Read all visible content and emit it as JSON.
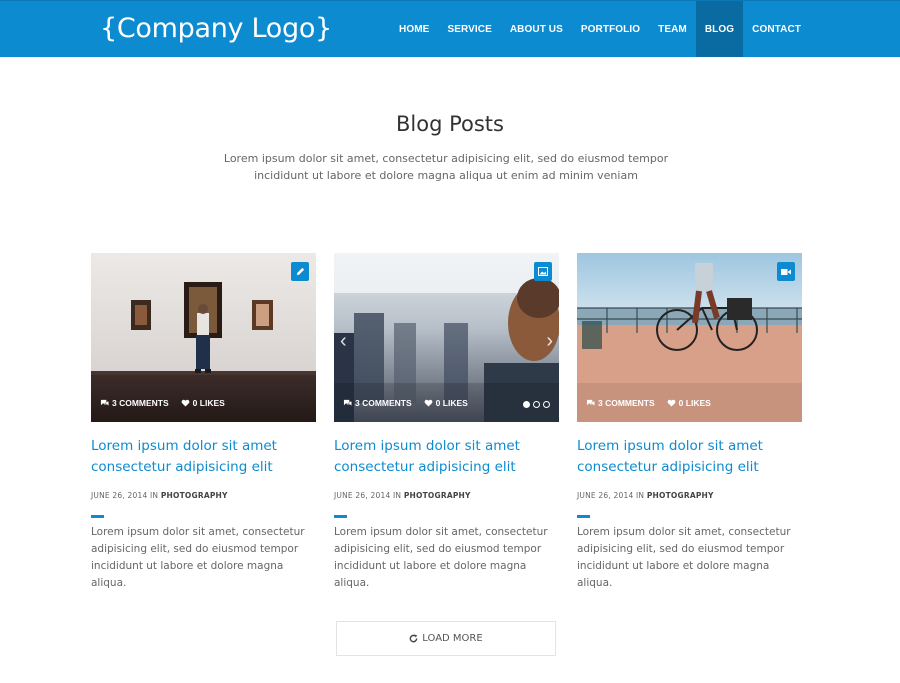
{
  "header": {
    "logo": "{Company Logo}",
    "nav": [
      "HOME",
      "SERVICE",
      "ABOUT US",
      "PORTFOLIO",
      "TEAM",
      "BLOG",
      "CONTACT"
    ],
    "active": "BLOG"
  },
  "section": {
    "title": "Blog Posts",
    "subtitle": "Lorem ipsum dolor sit amet, consectetur adipisicing elit, sed do eiusmod tempor incididunt ut labore et dolore magna aliqua ut enim ad minim veniam"
  },
  "posts": [
    {
      "type_icon": "pencil-icon",
      "comments": "3 COMMENTS",
      "likes": "0 LIKES",
      "title": "Lorem ipsum dolor sit amet consectetur adipisicing elit",
      "date": "JUNE 26, 2014 IN",
      "category": "PHOTOGRAPHY",
      "excerpt": "Lorem ipsum dolor sit amet, consectetur adipisicing elit, sed do eiusmod tempor incididunt ut labore et dolore magna aliqua."
    },
    {
      "type_icon": "image-icon",
      "comments": "3 COMMENTS",
      "likes": "0 LIKES",
      "title": "Lorem ipsum dolor sit amet consectetur adipisicing elit",
      "date": "JUNE 26, 2014 IN",
      "category": "PHOTOGRAPHY",
      "excerpt": "Lorem ipsum dolor sit amet, consectetur adipisicing elit, sed do eiusmod tempor incididunt ut labore et dolore magna aliqua."
    },
    {
      "type_icon": "video-icon",
      "comments": "3 COMMENTS",
      "likes": "0 LIKES",
      "title": "Lorem ipsum dolor sit amet consectetur adipisicing elit",
      "date": "JUNE 26, 2014 IN",
      "category": "PHOTOGRAPHY",
      "excerpt": "Lorem ipsum dolor sit amet, consectetur adipisicing elit, sed do eiusmod tempor incididunt ut labore et dolore magna aliqua."
    }
  ],
  "load_more": "LOAD MORE",
  "colors": {
    "accent": "#0d8bd0",
    "active_nav": "#0a6aa2"
  }
}
